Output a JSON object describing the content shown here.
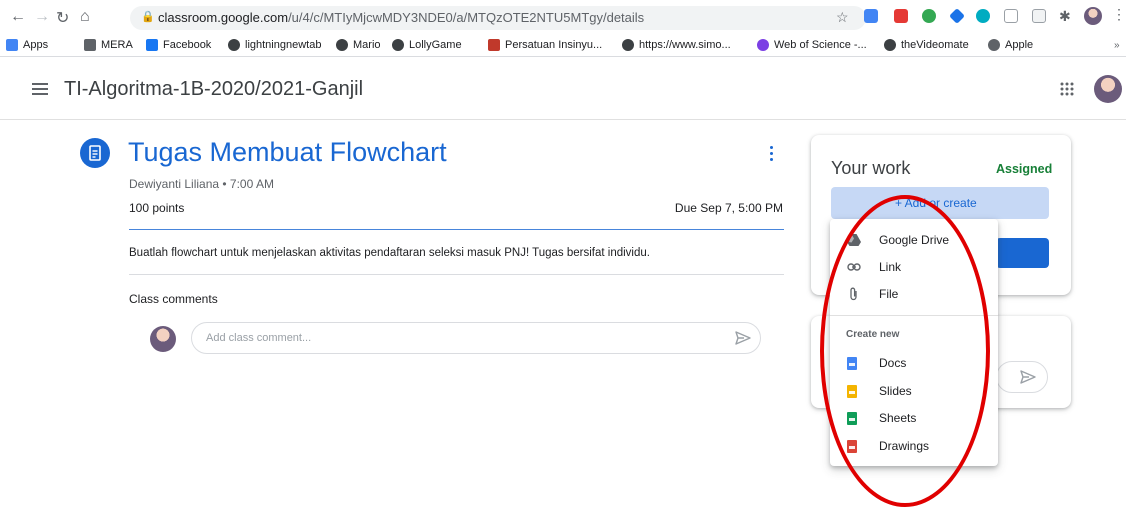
{
  "browser": {
    "url_host": "classroom.google.com",
    "url_path": "/u/4/c/MTIyMjcwMDY3NDE0/a/MTQzOTE2NTU5MTgy/details",
    "bookmarks": [
      {
        "label": "Apps",
        "icon": "apps-grid-icon",
        "color": "#4285f4"
      },
      {
        "label": "MERA",
        "icon": "folder-icon",
        "color": "#5f6368"
      },
      {
        "label": "Facebook",
        "icon": "facebook-icon",
        "color": "#1877f2"
      },
      {
        "label": "lightningnewtab",
        "icon": "globe-icon",
        "color": "#3c4043"
      },
      {
        "label": "Mario",
        "icon": "globe-icon",
        "color": "#3c4043"
      },
      {
        "label": "LollyGame",
        "icon": "globe-icon",
        "color": "#3c4043"
      },
      {
        "label": "Persatuan Insinyu...",
        "icon": "pii-logo-icon",
        "color": "#c0392b"
      },
      {
        "label": "https://www.simo...",
        "icon": "globe-icon",
        "color": "#3c4043"
      },
      {
        "label": "Web of Science -...",
        "icon": "wos-icon",
        "color": "#7b3fe4"
      },
      {
        "label": "theVideomate",
        "icon": "globe-icon",
        "color": "#3c4043"
      },
      {
        "label": "Apple",
        "icon": "apple-icon",
        "color": "#5f6368"
      }
    ]
  },
  "header": {
    "class_name": "TI-Algoritma-1B-2020/2021-Ganjil"
  },
  "assignment": {
    "title": "Tugas Membuat Flowchart",
    "meta": "Dewiyanti Liliana • 7:00 AM",
    "points": "100 points",
    "due": "Due Sep 7, 5:00 PM",
    "instructions": "Buatlah flowchart untuk menjelaskan aktivitas pendaftaran seleksi masuk PNJ! Tugas bersifat individu.",
    "comments_label": "Class comments",
    "comment_placeholder": "Add class comment..."
  },
  "your_work": {
    "title": "Your work",
    "status": "Assigned",
    "add_label": "+ Add or create",
    "status_color": "#188038"
  },
  "menu": {
    "attach_items": [
      {
        "label": "Google Drive",
        "icon": "google-drive-icon"
      },
      {
        "label": "Link",
        "icon": "link-icon"
      },
      {
        "label": "File",
        "icon": "paperclip-icon"
      }
    ],
    "create_header": "Create new",
    "create_items": [
      {
        "label": "Docs",
        "icon": "docs-icon",
        "color": "#4285f4"
      },
      {
        "label": "Slides",
        "icon": "slides-icon",
        "color": "#f4b400"
      },
      {
        "label": "Sheets",
        "icon": "sheets-icon",
        "color": "#0f9d58"
      },
      {
        "label": "Drawings",
        "icon": "drawings-icon",
        "color": "#db4437"
      }
    ]
  },
  "colors": {
    "accent": "#1967d2",
    "annotation_ellipse": "#e00000"
  }
}
